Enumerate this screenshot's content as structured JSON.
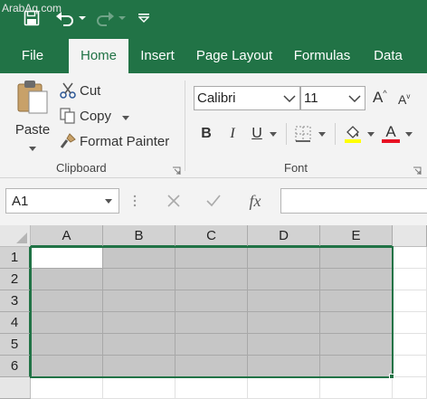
{
  "watermark": "ArabAq.com",
  "quick_access": {
    "save_icon": "save-icon",
    "undo_icon": "undo-icon",
    "redo_icon": "redo-icon",
    "customize_icon": "customize-qat-icon"
  },
  "tabs": [
    {
      "label": "File"
    },
    {
      "label": "Home"
    },
    {
      "label": "Insert"
    },
    {
      "label": "Page Layout"
    },
    {
      "label": "Formulas"
    },
    {
      "label": "Data"
    }
  ],
  "active_tab": "Home",
  "clipboard": {
    "paste_label": "Paste",
    "cut_label": "Cut",
    "copy_label": "Copy",
    "format_painter_label": "Format Painter",
    "group_label": "Clipboard"
  },
  "font": {
    "family": "Calibri",
    "size": "11",
    "bold_label": "B",
    "italic_label": "I",
    "underline_label": "U",
    "grow_label": "A",
    "shrink_label": "A",
    "color_label": "A",
    "group_label": "Font",
    "highlight_color": "#ffff00",
    "font_color": "#e81123"
  },
  "formula_bar": {
    "name_box": "A1",
    "cancel_icon": "cancel-icon",
    "enter_icon": "enter-icon",
    "fx_label": "fx",
    "formula": ""
  },
  "grid": {
    "columns": [
      "A",
      "B",
      "C",
      "D",
      "E"
    ],
    "rows": [
      "1",
      "2",
      "3",
      "4",
      "5",
      "6"
    ],
    "active_cell": "A1",
    "selection": "A1:E6"
  },
  "colors": {
    "accent": "#217346",
    "selection_fill": "#c6c6c6"
  }
}
